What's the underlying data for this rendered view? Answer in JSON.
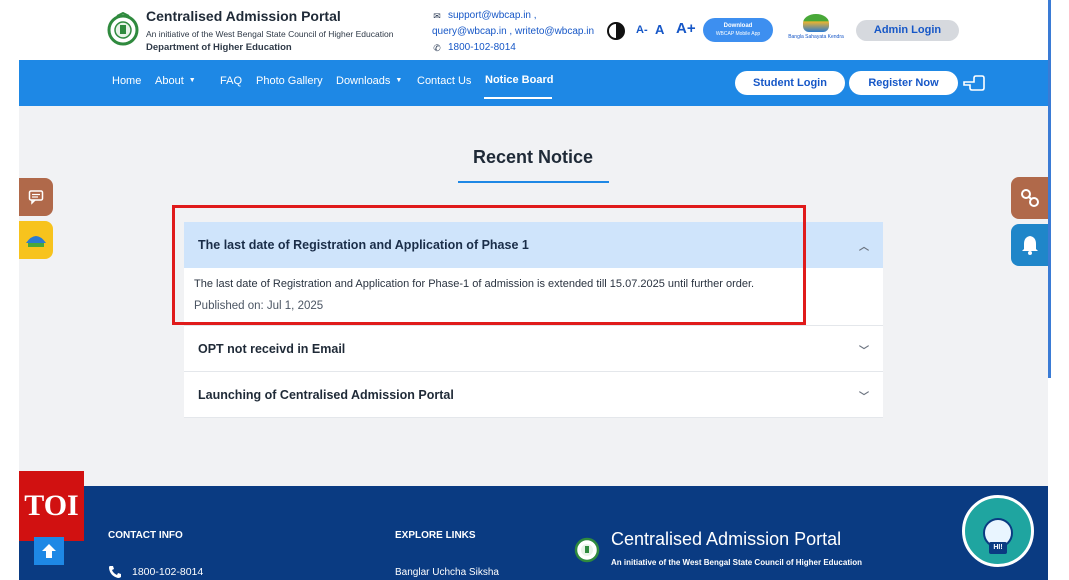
{
  "header": {
    "brand_title": "Centralised Admission Portal",
    "brand_subtitle": "An initiative of the West Bengal State Council of Higher Education",
    "brand_department": "Department of Higher Education",
    "emails_line1": "support@wbcap.in ,",
    "emails_line2": "query@wbcap.in , writeto@wbcap.in",
    "phone": "1800-102-8014",
    "font_small": "A-",
    "font_normal": "A",
    "font_large": "A+",
    "app_download": "Download",
    "app_sub": "WBCAP Mobile App",
    "kendra_label": "Bangla Sahayata Kendra",
    "admin_login": "Admin Login"
  },
  "nav": {
    "items": [
      {
        "label": "Home"
      },
      {
        "label": "About"
      },
      {
        "label": "FAQ"
      },
      {
        "label": "Photo Gallery"
      },
      {
        "label": "Downloads"
      },
      {
        "label": "Contact Us"
      },
      {
        "label": "Notice Board"
      }
    ],
    "student_login": "Student Login",
    "register_now": "Register Now"
  },
  "main": {
    "section_title": "Recent Notice",
    "notices": [
      {
        "title": "The last date of Registration and Application of Phase 1",
        "body": "The last date of Registration and Application for Phase-1 of admission is extended till 15.07.2025 until further order.",
        "published": "Published on: Jul 1, 2025",
        "expanded": true
      },
      {
        "title": "OPT not receivd in Email",
        "expanded": false
      },
      {
        "title": "Launching of Centralised Admission Portal",
        "expanded": false
      }
    ]
  },
  "footer": {
    "contact_heading": "CONTACT INFO",
    "contact_phone": "1800-102-8014",
    "explore_heading": "EXPLORE LINKS",
    "explore_first_link": "Banglar Uchcha Siksha",
    "brand_title": "Centralised Admission Portal",
    "brand_subtitle": "An initiative of the West Bengal State Council of Higher Education",
    "chatbot_badge": "HI!"
  },
  "overlay": {
    "toi_label": "TOI"
  },
  "colors": {
    "primary": "#1e88e5",
    "footer": "#0a3b82",
    "highlight": "#e01b1b",
    "accent_brown": "#b0694a"
  }
}
